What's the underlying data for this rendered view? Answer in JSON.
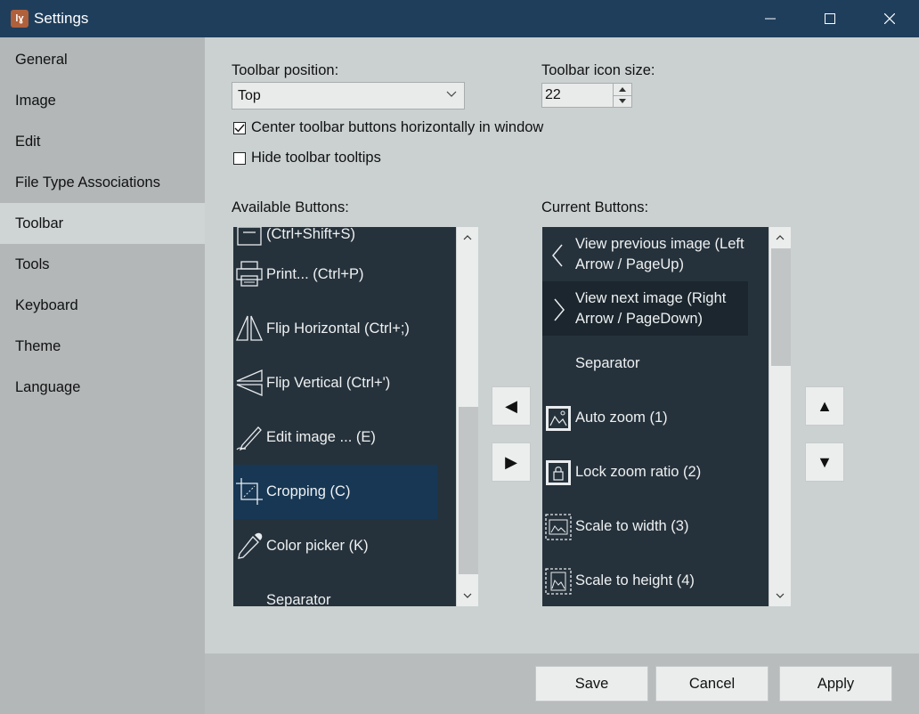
{
  "window": {
    "title": "Settings",
    "app_icon_text": "lɣ"
  },
  "sidebar": {
    "items": [
      {
        "label": "General"
      },
      {
        "label": "Image"
      },
      {
        "label": "Edit"
      },
      {
        "label": "File Type Associations"
      },
      {
        "label": "Toolbar",
        "active": true
      },
      {
        "label": "Tools"
      },
      {
        "label": "Keyboard"
      },
      {
        "label": "Theme"
      },
      {
        "label": "Language"
      }
    ]
  },
  "toolbar_settings": {
    "position_label": "Toolbar position:",
    "position_value": "Top",
    "icon_size_label": "Toolbar icon size:",
    "icon_size_value": "22",
    "center_label": "Center toolbar buttons horizontally in window",
    "center_checked": true,
    "hide_tooltips_label": "Hide toolbar tooltips",
    "hide_tooltips_checked": false
  },
  "available": {
    "label": "Available Buttons:",
    "items": [
      {
        "label": "(Ctrl+Shift+S)",
        "icon": "save-as-icon"
      },
      {
        "label": "Print... (Ctrl+P)",
        "icon": "printer-icon"
      },
      {
        "label": "Flip Horizontal (Ctrl+;)",
        "icon": "flip-horizontal-icon"
      },
      {
        "label": "Flip Vertical (Ctrl+')",
        "icon": "flip-vertical-icon"
      },
      {
        "label": "Edit image ... (E)",
        "icon": "pen-icon"
      },
      {
        "label": "Cropping (C)",
        "icon": "crop-icon",
        "selected": true
      },
      {
        "label": "Color picker (K)",
        "icon": "eyedropper-icon"
      },
      {
        "label": "Separator",
        "icon": ""
      }
    ]
  },
  "current": {
    "label": "Current Buttons:",
    "items": [
      {
        "line1": "View previous image (Left",
        "line2": "Arrow / PageUp)",
        "icon": "chevron-left-icon"
      },
      {
        "line1": "View next image (Right",
        "line2": "Arrow / PageDown)",
        "icon": "chevron-right-icon"
      },
      {
        "line1": "Separator",
        "line2": "",
        "icon": ""
      },
      {
        "line1": "Auto zoom (1)",
        "line2": "",
        "icon": "auto-zoom-icon"
      },
      {
        "line1": "Lock zoom ratio (2)",
        "line2": "",
        "icon": "lock-zoom-icon"
      },
      {
        "line1": "Scale to width (3)",
        "line2": "",
        "icon": "scale-width-icon"
      },
      {
        "line1": "Scale to height (4)",
        "line2": "",
        "icon": "scale-height-icon"
      }
    ]
  },
  "move_buttons": {
    "add": "◀",
    "remove": "▶",
    "up": "▲",
    "down": "▼"
  },
  "footer": {
    "save": "Save",
    "cancel": "Cancel",
    "apply": "Apply"
  },
  "colors": {
    "titlebar": "#1f3e5c",
    "list_bg": "#26323b",
    "selected": "#173754",
    "sidebar": "#b3b7b8",
    "content": "#cbd1d1"
  }
}
